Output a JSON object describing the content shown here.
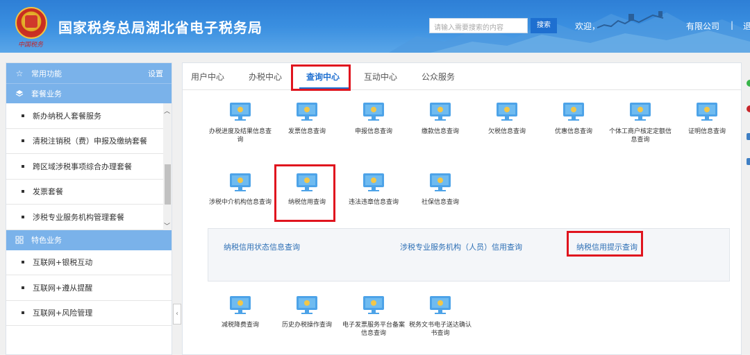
{
  "header": {
    "emblem_script": "中国税务",
    "title": "国家税务总局湖北省电子税务局",
    "search_placeholder": "请输入需要搜索的内容",
    "search_button": "搜索",
    "welcome": "欢迎，",
    "company": "有限公司",
    "separator": "|",
    "exit": "退出"
  },
  "sidebar": {
    "common": {
      "label": "常用功能",
      "settings": "设置",
      "icon": "star-icon"
    },
    "package": {
      "label": "套餐业务",
      "icon": "layers-icon"
    },
    "package_items": [
      "新办纳税人套餐服务",
      "清税注销税（费）申报及缴纳套餐",
      "跨区域涉税事项综合办理套餐",
      "发票套餐",
      "涉税专业服务机构管理套餐"
    ],
    "featured": {
      "label": "特色业务",
      "icon": "grid-icon"
    },
    "featured_items": [
      "互联网+银税互动",
      "互联网+遵从提醒",
      "互联网+风险管理"
    ],
    "collapse_icon": "chevron-left-icon"
  },
  "tabs": [
    "用户中心",
    "办税中心",
    "查询中心",
    "互动中心",
    "公众服务"
  ],
  "active_tab": "查询中心",
  "query_items": {
    "row1": [
      "办税进度及结果信息查询",
      "发票信息查询",
      "申报信息查询",
      "缴款信息查询",
      "欠税信息查询",
      "优惠信息查询",
      "个体工商户核定定额信息查询",
      "证明信息查询"
    ],
    "row2": [
      "涉税中介机构信息查询",
      "纳税信用查询",
      "违法违章信息查询",
      "社保信息查询"
    ],
    "row3": [
      "减税降费查询",
      "历史办税操作查询",
      "电子发票服务平台备案信息查询",
      "税务文书电子送达确认书查询"
    ]
  },
  "subpanel_links": [
    "纳税信用状态信息查询",
    "涉税专业服务机构（人员）信用查询",
    "纳税信用提示查询"
  ],
  "colors": {
    "accent": "#1e6fd0",
    "sidebar_header": "#7ab2ea",
    "highlight": "#e0141e",
    "link": "#2d6fb5"
  }
}
